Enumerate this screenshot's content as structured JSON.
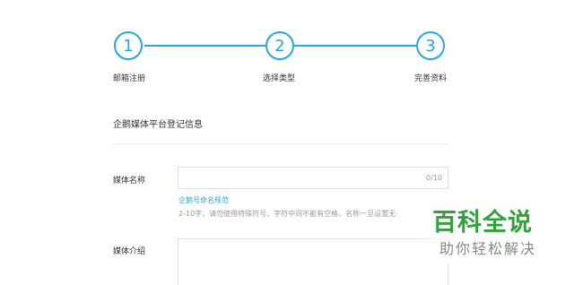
{
  "steps": [
    {
      "number": "1",
      "label": "邮箱注册"
    },
    {
      "number": "2",
      "label": "选择类型"
    },
    {
      "number": "3",
      "label": "完善资料"
    }
  ],
  "colors": {
    "accent": "#29a6e0",
    "watermark_green": "#2fa339"
  },
  "section": {
    "title": "企鹅媒体平台登记信息"
  },
  "media_name": {
    "label": "媒体名称",
    "counter": "0/10",
    "rule_link": "企鹅号命名规范",
    "hint": "2-10字，请勿使用特殊符号，字符中间不能有空格，名称一旦设置无"
  },
  "media_intro": {
    "label": "媒体介绍"
  },
  "watermark": {
    "title": "百科全说",
    "subtitle": "助你轻松解决"
  }
}
